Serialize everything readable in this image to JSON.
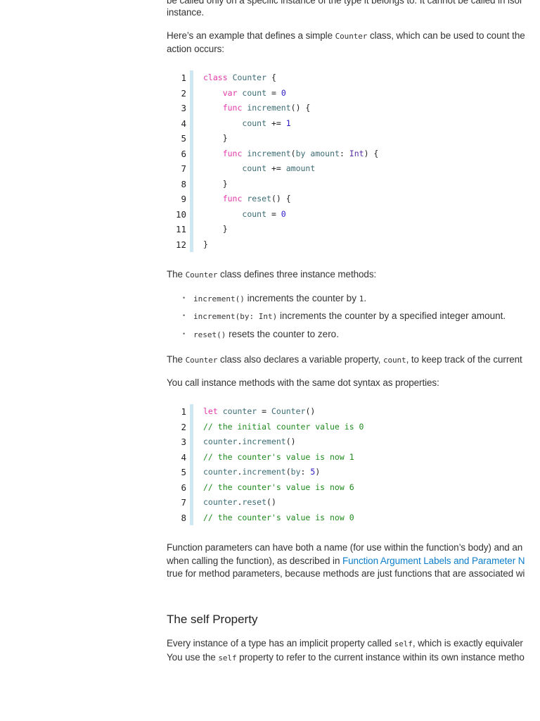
{
  "intro": {
    "line1": "be called only on a specific instance of the type it belongs to. It cannot be called in isol",
    "line2": "instance.",
    "example_pre": "Here’s an example that defines a simple ",
    "example_code": "Counter",
    "example_post": " class, which can be used to count the",
    "example_line2": "action occurs:"
  },
  "code1": [
    [
      [
        "k",
        "class"
      ],
      [
        "o",
        " "
      ],
      [
        "i",
        "Counter"
      ],
      [
        "o",
        " {"
      ]
    ],
    [
      [
        "o",
        "    "
      ],
      [
        "k",
        "var"
      ],
      [
        "o",
        " "
      ],
      [
        "i",
        "count"
      ],
      [
        "o",
        " = "
      ],
      [
        "n",
        "0"
      ]
    ],
    [
      [
        "o",
        "    "
      ],
      [
        "k",
        "func"
      ],
      [
        "o",
        " "
      ],
      [
        "i",
        "increment"
      ],
      [
        "o",
        "() {"
      ]
    ],
    [
      [
        "o",
        "        "
      ],
      [
        "i",
        "count"
      ],
      [
        "o",
        " += "
      ],
      [
        "n",
        "1"
      ]
    ],
    [
      [
        "o",
        "    }"
      ]
    ],
    [
      [
        "o",
        "    "
      ],
      [
        "k",
        "func"
      ],
      [
        "o",
        " "
      ],
      [
        "i",
        "increment"
      ],
      [
        "o",
        "("
      ],
      [
        "i",
        "by"
      ],
      [
        "o",
        " "
      ],
      [
        "i",
        "amount"
      ],
      [
        "o",
        ": "
      ],
      [
        "t",
        "Int"
      ],
      [
        "o",
        ") {"
      ]
    ],
    [
      [
        "o",
        "        "
      ],
      [
        "i",
        "count"
      ],
      [
        "o",
        " += "
      ],
      [
        "i",
        "amount"
      ]
    ],
    [
      [
        "o",
        "    }"
      ]
    ],
    [
      [
        "o",
        "    "
      ],
      [
        "k",
        "func"
      ],
      [
        "o",
        " "
      ],
      [
        "i",
        "reset"
      ],
      [
        "o",
        "() {"
      ]
    ],
    [
      [
        "o",
        "        "
      ],
      [
        "i",
        "count"
      ],
      [
        "o",
        " = "
      ],
      [
        "n",
        "0"
      ]
    ],
    [
      [
        "o",
        "    }"
      ]
    ],
    [
      [
        "o",
        "}"
      ]
    ]
  ],
  "methods_intro": {
    "pre": "The ",
    "code": "Counter",
    "post": " class defines three instance methods:"
  },
  "bullets": [
    {
      "code": "increment()",
      "text": " increments the counter by ",
      "code2": "1",
      "text2": "."
    },
    {
      "code": "increment(by: Int)",
      "text": " increments the counter by a specified integer amount.",
      "code2": "",
      "text2": ""
    },
    {
      "code": "reset()",
      "text": " resets the counter to zero.",
      "code2": "",
      "text2": ""
    }
  ],
  "property_para": {
    "pre": "The ",
    "code": "Counter",
    "mid": " class also declares a variable property, ",
    "code2": "count",
    "post": ", to keep track of the current"
  },
  "dot_para": "You call instance methods with the same dot syntax as properties:",
  "code2": [
    [
      [
        "k",
        "let"
      ],
      [
        "o",
        " "
      ],
      [
        "i",
        "counter"
      ],
      [
        "o",
        " = "
      ],
      [
        "i",
        "Counter"
      ],
      [
        "o",
        "()"
      ]
    ],
    [
      [
        "c",
        "// the initial counter value is 0"
      ]
    ],
    [
      [
        "i",
        "counter"
      ],
      [
        "o",
        "."
      ],
      [
        "i",
        "increment"
      ],
      [
        "o",
        "()"
      ]
    ],
    [
      [
        "c",
        "// the counter's value is now 1"
      ]
    ],
    [
      [
        "i",
        "counter"
      ],
      [
        "o",
        "."
      ],
      [
        "i",
        "increment"
      ],
      [
        "o",
        "("
      ],
      [
        "i",
        "by"
      ],
      [
        "o",
        ": "
      ],
      [
        "n",
        "5"
      ],
      [
        "o",
        ")"
      ]
    ],
    [
      [
        "c",
        "// the counter's value is now 6"
      ]
    ],
    [
      [
        "i",
        "counter"
      ],
      [
        "o",
        "."
      ],
      [
        "i",
        "reset"
      ],
      [
        "o",
        "()"
      ]
    ],
    [
      [
        "c",
        "// the counter's value is now 0"
      ]
    ]
  ],
  "params_para": {
    "line1": "Function parameters can have both a name (for use within the function’s body) and an",
    "line2_pre": "when calling the function), as described in ",
    "link": "Function Argument Labels and Parameter N",
    "line3": "true for method parameters, because methods are just functions that are associated wi"
  },
  "self_heading": "The self Property",
  "self_para": {
    "l1_pre": "Every instance of a type has an implicit property called ",
    "l1_code": "self",
    "l1_post": ", which is exactly equivaler",
    "l2_pre": "You use the ",
    "l2_code": "self",
    "l2_post": " property to refer to the current instance within its own instance metho"
  }
}
